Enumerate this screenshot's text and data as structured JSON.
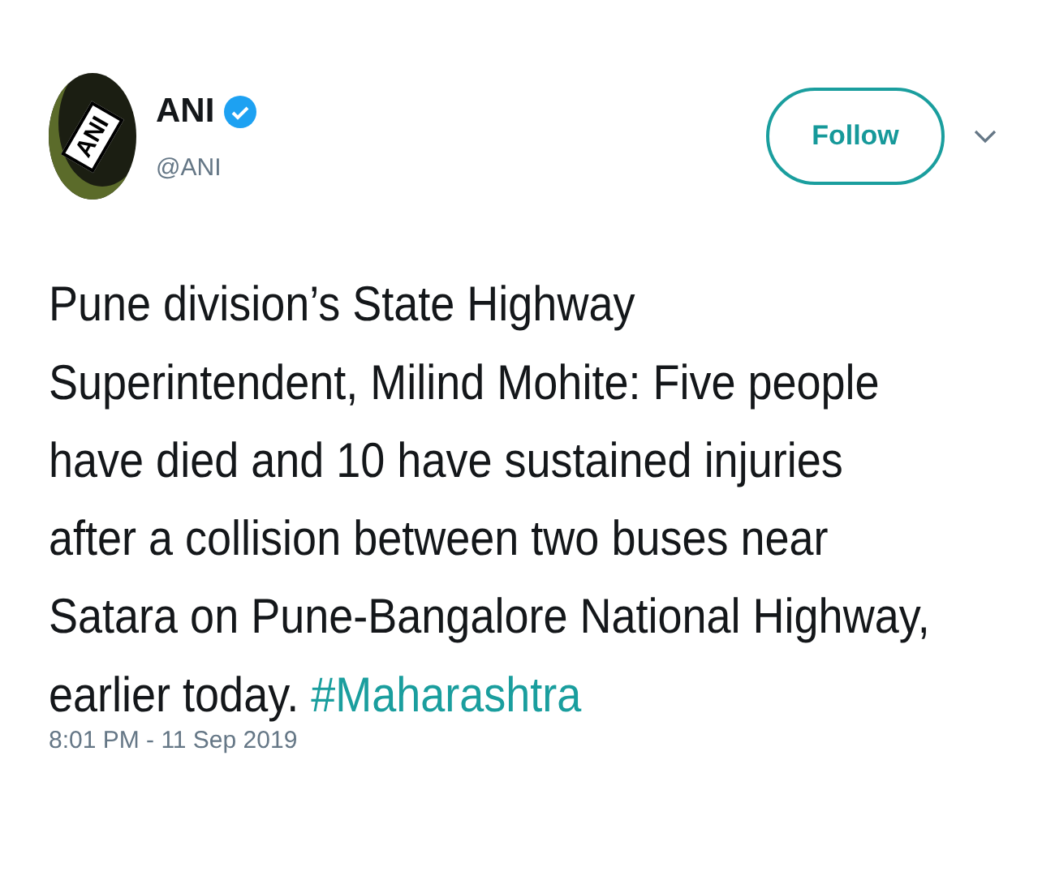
{
  "author": {
    "avatar_text": "ANI",
    "name": "ANI",
    "verified": true,
    "handle": "@ANI"
  },
  "follow_button": {
    "label": "Follow"
  },
  "tweet": {
    "lines": [
      "Pune division’s State Highway",
      "Superintendent, Milind Mohite: Five people",
      "have died and 10 have sustained injuries",
      "after a collision between two buses near",
      "Satara on Pune-Bangalore National Highway,",
      "earlier today."
    ],
    "hashtag": "#Maharashtra"
  },
  "timestamp": "8:01 PM - 11 Sep 2019"
}
